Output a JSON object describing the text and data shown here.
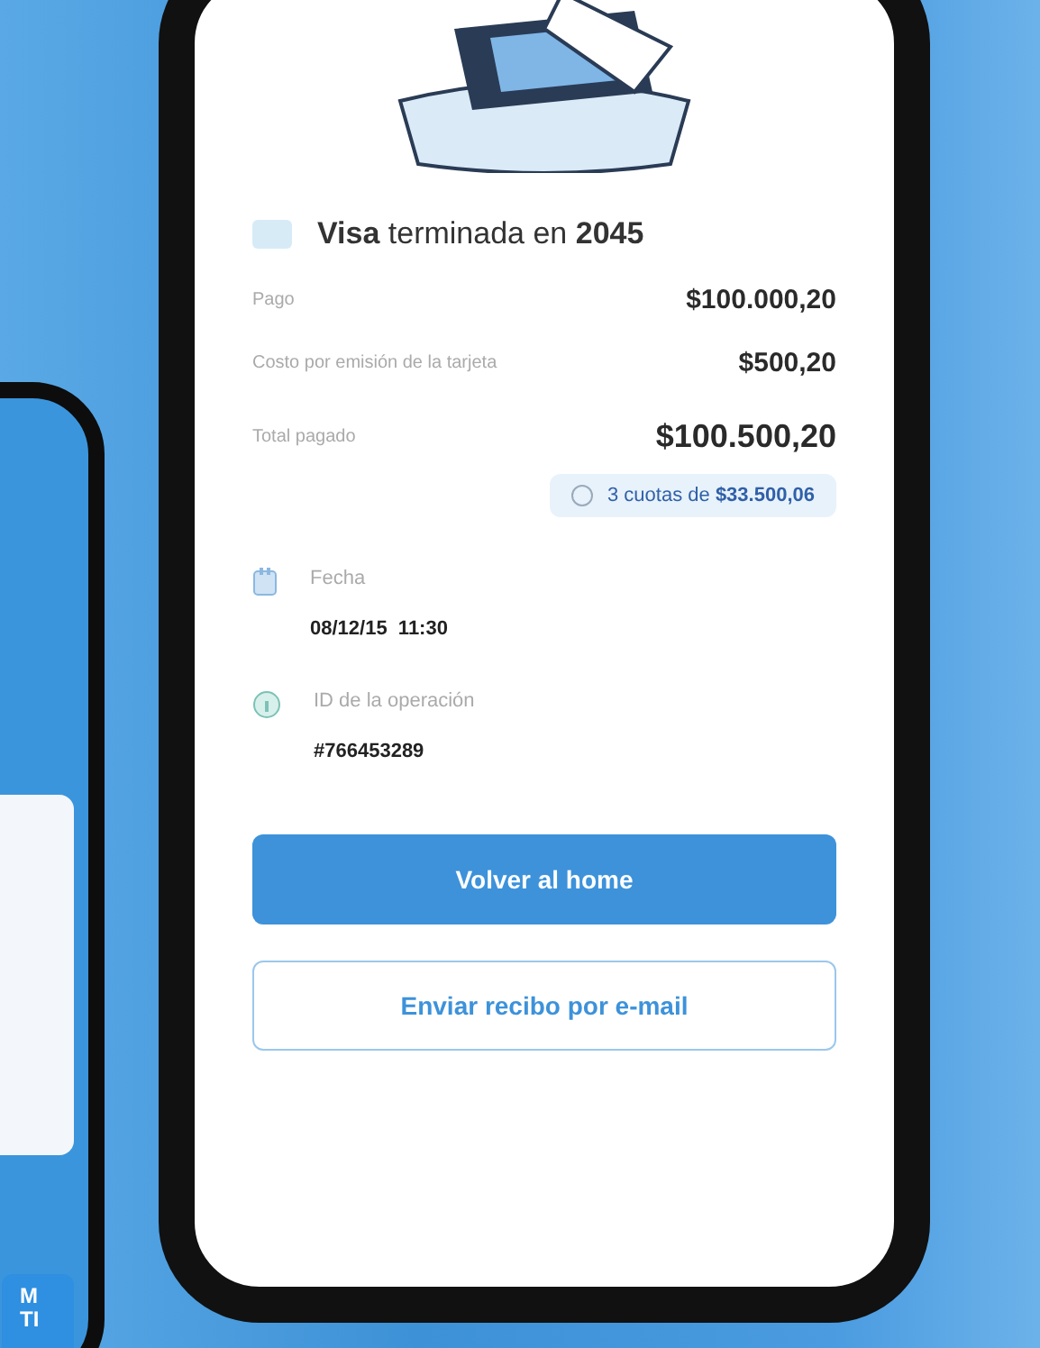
{
  "side_phone": {
    "tiles": [
      {
        "label": "M\nTI"
      }
    ]
  },
  "receipt": {
    "card": "**Visa** terminada en **2045**",
    "lines": [
      {
        "label": "Pago",
        "amount": "$100.000,20",
        "kind": "normal"
      },
      {
        "label": "Costo por emisión de la tarjeta",
        "amount": "$500,20",
        "kind": "normal"
      },
      {
        "label": "Total pagado",
        "amount": "$100.500,20",
        "kind": "total"
      }
    ],
    "installments": "3 cuotas de **$33.500,06**",
    "details": [
      {
        "kind": "date",
        "label": "Fecha",
        "value": "08/12/15  11:30"
      },
      {
        "kind": "id",
        "label": "ID de la operación",
        "value": "#766453289"
      }
    ],
    "primary_button": "Volver al home",
    "secondary_button": "Enviar recibo por e-mail"
  }
}
